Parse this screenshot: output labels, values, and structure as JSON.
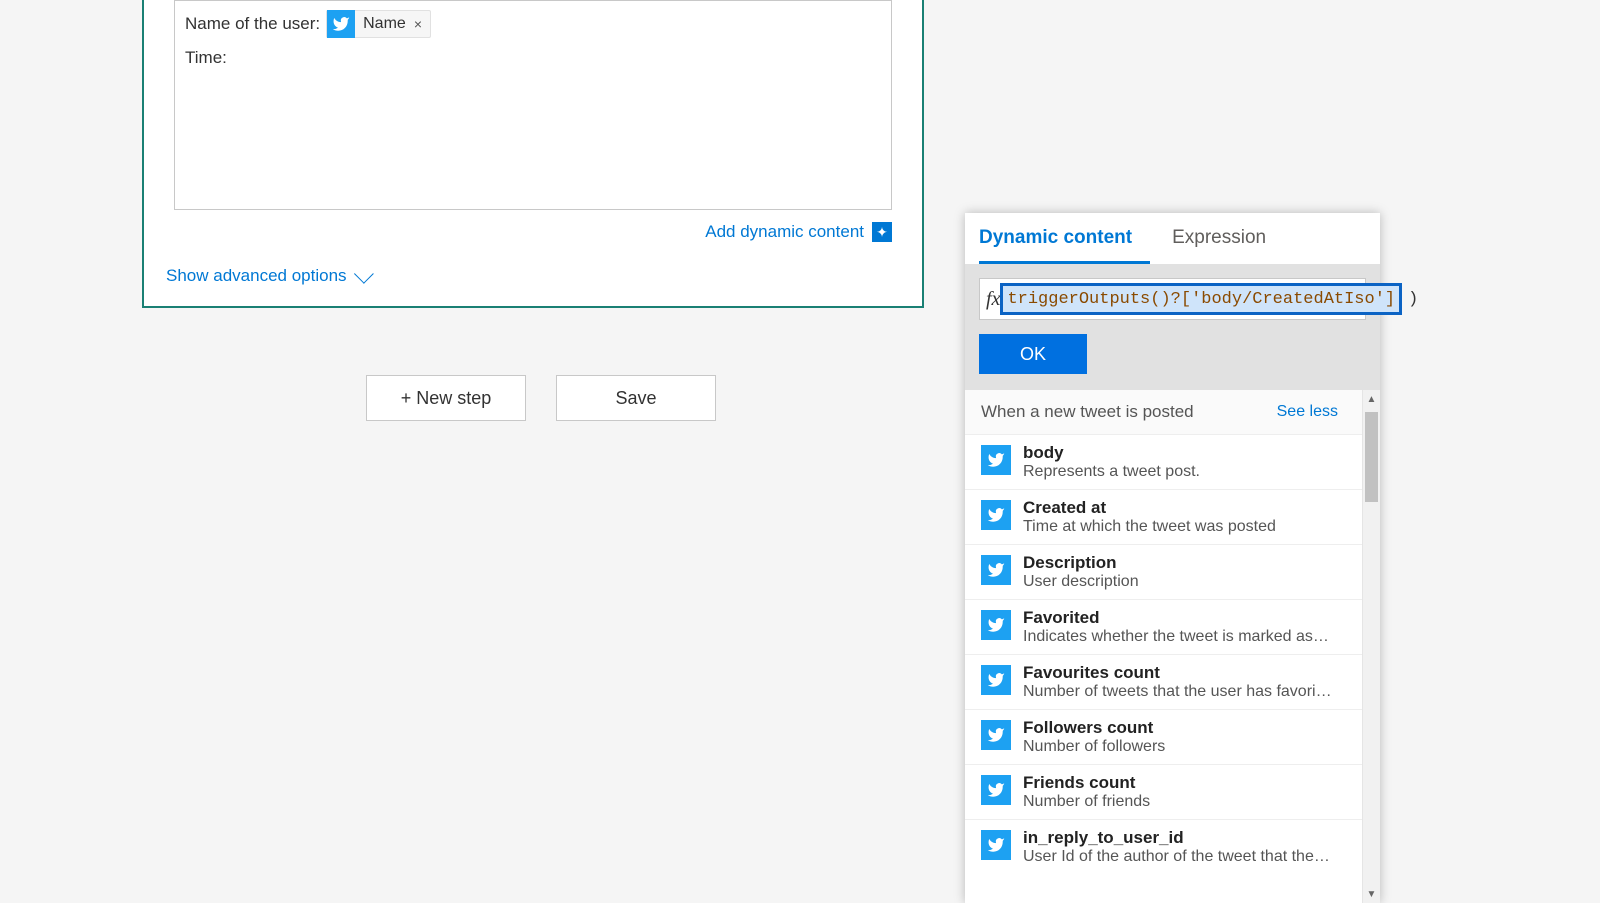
{
  "card": {
    "line1_label": "Name of the user:",
    "line2_label": "Time:",
    "token_name": "Name",
    "token_x": "×",
    "add_dynamic": "Add dynamic content",
    "show_advanced": "Show advanced options"
  },
  "buttons": {
    "new_step": "+ New step",
    "save": "Save"
  },
  "flyout": {
    "tabs": {
      "dynamic": "Dynamic content",
      "expression": "Expression"
    },
    "fx": "fx",
    "expression_value": "triggerOutputs()?['body/CreatedAtIso']",
    "trailing": ")",
    "ok": "OK",
    "section_title": "When a new tweet is posted",
    "see_less": "See less",
    "items": [
      {
        "title": "body",
        "desc": "Represents a tweet post."
      },
      {
        "title": "Created at",
        "desc": "Time at which the tweet was posted"
      },
      {
        "title": "Description",
        "desc": "User description"
      },
      {
        "title": "Favorited",
        "desc": "Indicates whether the tweet is marked as favorited or not"
      },
      {
        "title": "Favourites count",
        "desc": "Number of tweets that the user has favorited"
      },
      {
        "title": "Followers count",
        "desc": "Number of followers"
      },
      {
        "title": "Friends count",
        "desc": "Number of friends"
      },
      {
        "title": "in_reply_to_user_id",
        "desc": "User Id of the author of the tweet that the current tweet i"
      }
    ]
  }
}
